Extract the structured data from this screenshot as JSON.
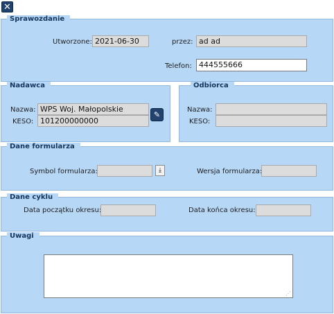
{
  "toolbar": {
    "close_icon": "close-icon"
  },
  "sprawozdanie": {
    "title": "Sprawozdanie",
    "utworzone_label": "Utworzone:",
    "utworzone_value": "2021-06-30",
    "przez_label": "przez:",
    "przez_value": "ad ad",
    "telefon_label": "Telefon:",
    "telefon_value": "444555666"
  },
  "nadawca": {
    "title": "Nadawca",
    "nazwa_label": "Nazwa:",
    "nazwa_value": "WPS Woj. Małopolskie",
    "keso_label": "KESO:",
    "keso_value": "101200000000",
    "edit_icon": "pencil-icon"
  },
  "odbiorca": {
    "title": "Odbiorca",
    "nazwa_label": "Nazwa:",
    "nazwa_value": "",
    "keso_label": "KESO:",
    "keso_value": ""
  },
  "dane_formularza": {
    "title": "Dane formularza",
    "symbol_label": "Symbol formularza:",
    "symbol_value": "",
    "wersja_label": "Wersja formularza:",
    "wersja_value": "",
    "download_icon": "download-icon"
  },
  "dane_cyklu": {
    "title": "Dane cyklu",
    "poczatek_label": "Data początku okresu:",
    "poczatek_value": "",
    "koniec_label": "Data końca okresu:",
    "koniec_value": ""
  },
  "uwagi": {
    "title": "Uwagi",
    "value": ""
  }
}
